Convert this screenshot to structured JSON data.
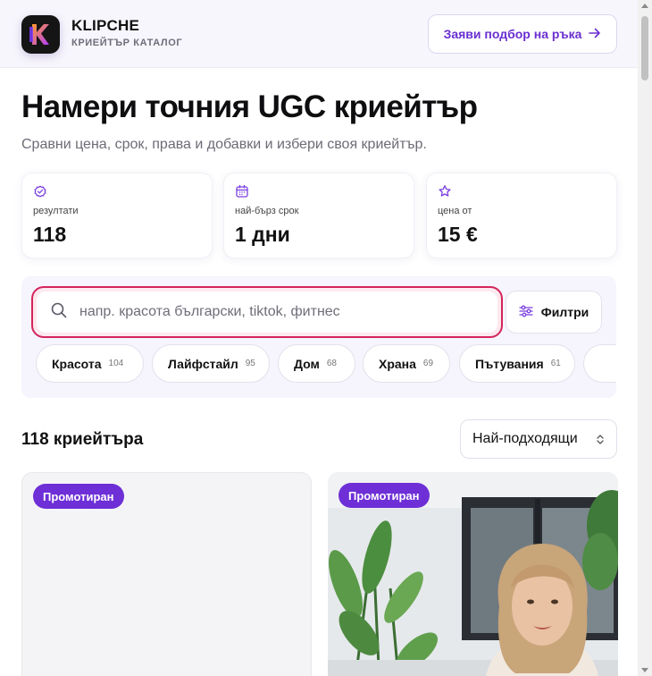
{
  "colors": {
    "accent": "#6a2fd1",
    "badge": "#6e2fd6",
    "search_border": "#d4255a",
    "header_bg": "#f7f6fc",
    "panel_bg": "#f6f4fd"
  },
  "header": {
    "brand_name": "KLIPCHE",
    "brand_sub": "КРИЕЙТЪР КАТАЛОГ",
    "cta_label": "Заяви подбор на ръка",
    "cta_icon": "arrow-right-icon"
  },
  "hero": {
    "title": "Намери точния UGC криейтър",
    "subtitle": "Сравни цена, срок, права и добавки и избери своя криейтър."
  },
  "stats": [
    {
      "icon": "check-badge-icon",
      "label": "резултати",
      "value": "118"
    },
    {
      "icon": "calendar-icon",
      "label": "най-бърз срок",
      "value": "1 дни"
    },
    {
      "icon": "star-icon",
      "label": "цена от",
      "value": "15 €"
    }
  ],
  "search": {
    "placeholder": "напр. красота български, tiktok, фитнес",
    "value": "",
    "icon": "search-icon"
  },
  "filters": {
    "label": "Филтри",
    "icon": "sliders-icon"
  },
  "categories": [
    {
      "name": "Красота",
      "count": "104"
    },
    {
      "name": "Лайфстайл",
      "count": "95"
    },
    {
      "name": "Дом",
      "count": "68"
    },
    {
      "name": "Храна",
      "count": "69"
    },
    {
      "name": "Пътувания",
      "count": "61"
    }
  ],
  "results": {
    "title": "118 криейтъра",
    "sort_selected": "Най-подходящи",
    "sort_icon": "chevron-updown-icon"
  },
  "cards": [
    {
      "badge": "Промотиран"
    },
    {
      "badge": "Промотиран"
    }
  ]
}
